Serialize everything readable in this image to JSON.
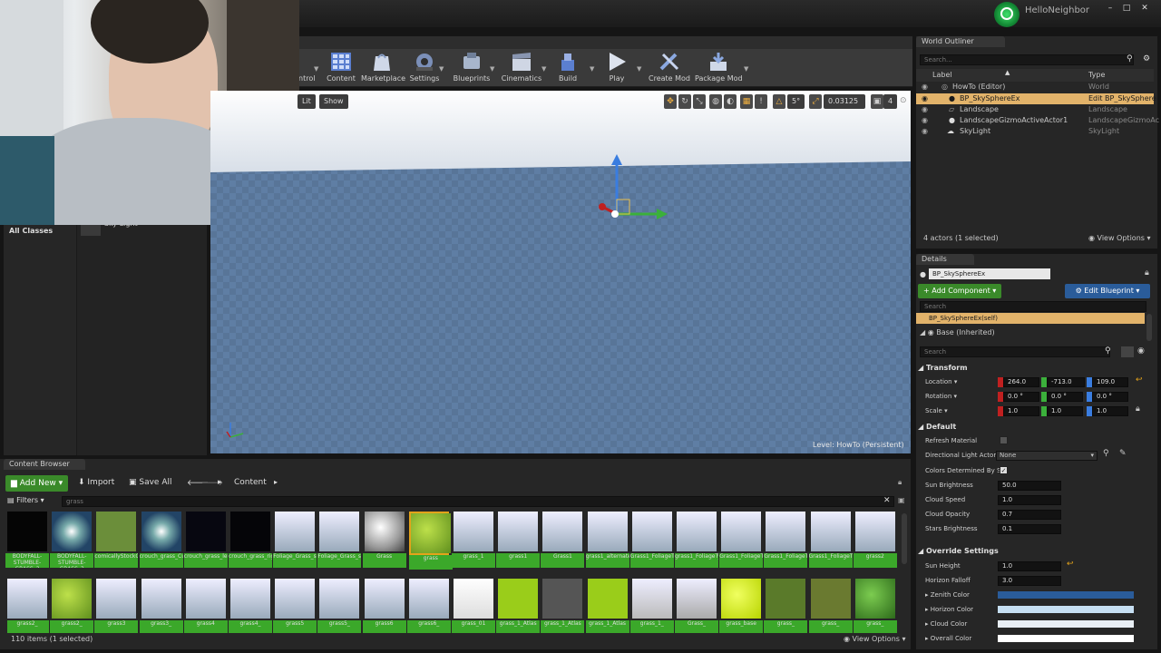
{
  "app": {
    "project_name": "HelloNeighbor"
  },
  "window_controls": {
    "minimize": "–",
    "maximize": "□",
    "close": "✕"
  },
  "toolbar": {
    "items": [
      {
        "label": "Control",
        "icon": "control-icon"
      },
      {
        "label": "Content",
        "icon": "content-icon"
      },
      {
        "label": "Marketplace",
        "icon": "marketplace-icon"
      },
      {
        "label": "Settings",
        "icon": "settings-icon"
      },
      {
        "label": "Blueprints",
        "icon": "blueprints-icon"
      },
      {
        "label": "Cinematics",
        "icon": "cinematics-icon"
      },
      {
        "label": "Build",
        "icon": "build-icon"
      },
      {
        "label": "Play",
        "icon": "play-icon"
      },
      {
        "label": "Create Mod",
        "icon": "create-mod-icon"
      },
      {
        "label": "Package Mod",
        "icon": "package-mod-icon"
      }
    ]
  },
  "viewport": {
    "lit_button": "Lit",
    "show_button": "Show",
    "angle_snap": "5°",
    "scale_snap": "0.03125",
    "camera_speed": "4",
    "level_label": "Level:  HowTo (Persistent)"
  },
  "modes_panel": {
    "category": "All Classes",
    "item": "Sky Light"
  },
  "world_outliner": {
    "tab": "World Outliner",
    "search_placeholder": "Search...",
    "col_label": "Label",
    "col_type": "Type",
    "rows": [
      {
        "label": "HowTo (Editor)",
        "type": "World"
      },
      {
        "label": "BP_SkySphereEx",
        "type": "Edit BP_SkySphere"
      },
      {
        "label": "Landscape",
        "type": "Landscape"
      },
      {
        "label": "LandscapeGizmoActiveActor1",
        "type": "LandscapeGizmoAc"
      },
      {
        "label": "SkyLight",
        "type": "SkyLight"
      }
    ],
    "status": "4 actors (1 selected)",
    "view_options": "View Options"
  },
  "details": {
    "tab": "Details",
    "name": "BP_SkySphereEx",
    "add_component": "+ Add Component",
    "edit_blueprint": "Edit Blueprint",
    "search": "Search",
    "self_row": "BP_SkySphereEx(self)",
    "base_row": "Base (Inherited)",
    "search2": "Search",
    "transform": {
      "header": "Transform",
      "location_label": "Location",
      "location": [
        "264.0",
        "-713.0",
        "109.0"
      ],
      "rotation_label": "Rotation",
      "rotation": [
        "0.0 °",
        "0.0 °",
        "0.0 °"
      ],
      "scale_label": "Scale",
      "scale": [
        "1.0",
        "1.0",
        "1.0"
      ]
    },
    "default": {
      "header": "Default",
      "refresh_material": "Refresh Material",
      "directional_light_actor": "Directional Light Actor",
      "directional_light_value": "None",
      "colors_determined": "Colors Determined By S",
      "sun_brightness": "Sun Brightness",
      "sun_brightness_val": "50.0",
      "cloud_speed": "Cloud Speed",
      "cloud_speed_val": "1.0",
      "cloud_opacity": "Cloud Opacity",
      "cloud_opacity_val": "0.7",
      "stars_brightness": "Stars Brightness",
      "stars_brightness_val": "0.1"
    },
    "override": {
      "header": "Override Settings",
      "sun_height": "Sun Height",
      "sun_height_val": "1.0",
      "horizon_falloff": "Horizon Falloff",
      "horizon_falloff_val": "3.0",
      "zenith_color": "Zenith Color",
      "horizon_color": "Horizon Color",
      "cloud_color": "Cloud Color",
      "overall_color": "Overall Color"
    }
  },
  "content_browser": {
    "tab": "Content Browser",
    "add_new": "Add New",
    "import": "Import",
    "save_all": "Save All",
    "path": "Content",
    "filters": "Filters",
    "search": "grass",
    "status": "110 items (1 selected)",
    "view_options": "View Options",
    "assets_row1": [
      "BODYFALL-STUMBLE-GRASS_3",
      "BODYFALL-STUMBLE-GRASS_3",
      "comicallyStockGrassTexture",
      "crouch_grass_Cue",
      "crouch_grass_left",
      "crouch_grass_right",
      "Foliage_Grass_stationary",
      "Foliage_Grass_stationary_OldArt",
      "Grass",
      "grass",
      "grass_1",
      "grass1",
      "Grass1",
      "grass1_alternate",
      "Grass1_FoliageType",
      "grass1_FoliageType",
      "Grass1_FoliageType_Close",
      "Grass1_FoliageType_Huge",
      "Grass1_FoliageType_City",
      "grass2"
    ],
    "assets_row2": [
      "grass2_",
      "grass2_",
      "grass3",
      "grass3_",
      "grass4",
      "grass4_",
      "grass5",
      "grass5_",
      "grass6",
      "grass6_",
      "grass_01",
      "grass_1_Atlas",
      "grass_1_Atlas",
      "grass_1_Atlas",
      "grass_1_",
      "Grass_",
      "grass_base",
      "grass_",
      "grass_",
      "grass_"
    ]
  },
  "colors": {
    "accent_green": "#3a8a2a",
    "selection_orange": "#e4a31a",
    "blueprint_blue": "#2a5c9a"
  }
}
